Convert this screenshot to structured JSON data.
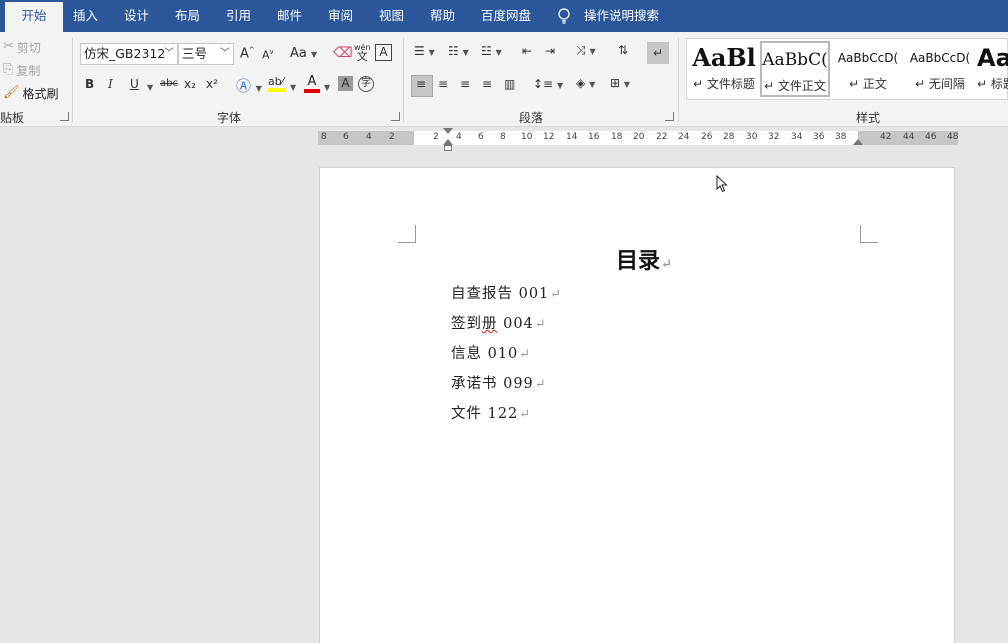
{
  "tabs": [
    "开始",
    "插入",
    "设计",
    "布局",
    "引用",
    "邮件",
    "审阅",
    "视图",
    "帮助",
    "百度网盘"
  ],
  "tell_me": "操作说明搜索",
  "clipboard": {
    "cut": "剪切",
    "copy": "复制",
    "format_painter": "格式刷",
    "label": "贴板"
  },
  "font": {
    "name": "仿宋_GB2312",
    "size": "三号",
    "label": "字体",
    "case_btn": "Aa",
    "grow": "A",
    "shrink": "A",
    "bold": "B",
    "italic": "I",
    "underline": "U",
    "strike": "abc",
    "sub": "x₂",
    "sup": "x²",
    "phonetic_top": "wén",
    "phonetic_bottom": "文",
    "border_char": "A",
    "shade_char": "A",
    "enclose_char": "字",
    "highlight_color": "#ffff00",
    "font_color": "#e00000"
  },
  "paragraph": {
    "label": "段落"
  },
  "styles": {
    "label": "样式",
    "items": [
      {
        "preview": "AaBl",
        "name": "文件标题"
      },
      {
        "preview": "AaBbC(",
        "name": "文件正文"
      },
      {
        "preview": "AaBbCcD(",
        "name": "正文"
      },
      {
        "preview": "AaBbCcD(",
        "name": "无间隔"
      },
      {
        "preview": "Aa",
        "name": "标题"
      }
    ]
  },
  "ruler": {
    "left_ticks": [
      "8",
      "6",
      "4",
      "2"
    ],
    "right_ticks": [
      "2",
      "4",
      "6",
      "8",
      "10",
      "12",
      "14",
      "16",
      "18",
      "20",
      "22",
      "24",
      "26",
      "28",
      "30",
      "32",
      "34",
      "36",
      "38"
    ],
    "margin_ticks": [
      "42",
      "44",
      "46",
      "48"
    ]
  },
  "document": {
    "title": "目录",
    "pilcrow": "↵",
    "lines": [
      {
        "text": "自查报告 001"
      },
      {
        "pre": "签到",
        "mis": "册",
        "post": " 004"
      },
      {
        "text": "信息 010"
      },
      {
        "text": "承诺书 099"
      },
      {
        "text": "文件 122"
      }
    ]
  },
  "colors": {
    "tab_bar": "#2b579a",
    "ribbon": "#f3f3f3",
    "workspace": "#e6e6e6"
  }
}
